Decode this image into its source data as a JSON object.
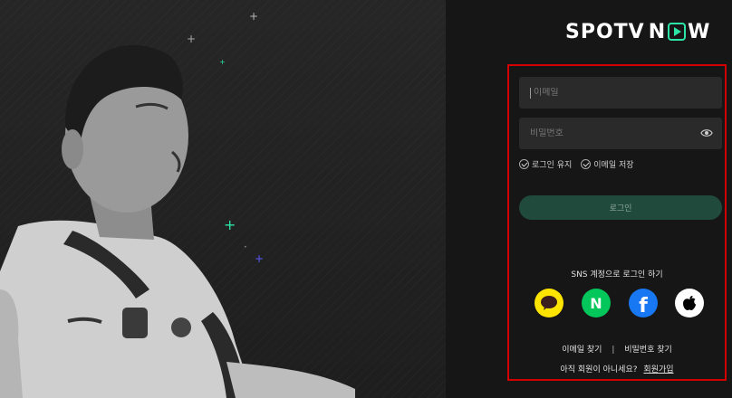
{
  "brand": {
    "logo_part1": "SPOTV",
    "logo_part2": "N",
    "logo_part3": "W",
    "accent_color": "#2ce6a6"
  },
  "login": {
    "email_placeholder": "이메일",
    "password_placeholder": "비밀번호",
    "keep_logged_in": "로그인 유지",
    "save_email": "이메일 저장",
    "login_button": "로그인"
  },
  "sns": {
    "title": "SNS 계정으로 로그인 하기",
    "providers": [
      {
        "name": "kakao",
        "icon": "kakao-talk-icon",
        "color": "#fee500"
      },
      {
        "name": "naver",
        "icon": "naver-icon",
        "color": "#03c75a",
        "glyph": "N"
      },
      {
        "name": "facebook",
        "icon": "facebook-icon",
        "color": "#1877f2",
        "glyph": "f"
      },
      {
        "name": "apple",
        "icon": "apple-icon",
        "color": "#ffffff"
      }
    ]
  },
  "footer": {
    "find_email": "이메일 찾기",
    "separator": "|",
    "find_password": "비밀번호 찾기",
    "not_member": "아직 회원이 아니세요?",
    "signup": "회원가입"
  }
}
